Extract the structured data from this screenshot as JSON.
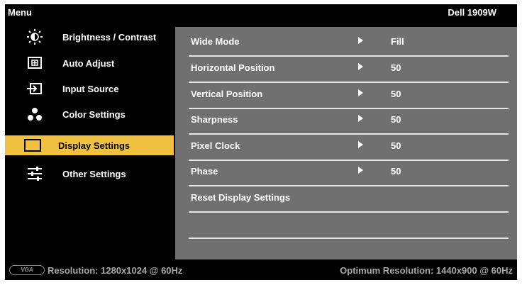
{
  "header": {
    "menu_title": "Menu",
    "model": "Dell 1909W"
  },
  "sidebar": {
    "items": [
      {
        "label": "Brightness / Contrast",
        "icon": "brightness-icon"
      },
      {
        "label": "Auto Adjust",
        "icon": "auto-adjust-icon"
      },
      {
        "label": "Input Source",
        "icon": "input-source-icon"
      },
      {
        "label": "Color Settings",
        "icon": "color-settings-icon"
      },
      {
        "label": "Display Settings",
        "icon": "display-settings-icon",
        "selected": true
      },
      {
        "label": "Other Settings",
        "icon": "other-settings-icon"
      }
    ],
    "selected_color": "#f0c040"
  },
  "panel": {
    "rows": [
      {
        "label": "Wide Mode",
        "value": "Fill"
      },
      {
        "label": "Horizontal Position",
        "value": "50"
      },
      {
        "label": "Vertical Position",
        "value": "50"
      },
      {
        "label": "Sharpness",
        "value": "50"
      },
      {
        "label": "Pixel Clock",
        "value": "50"
      },
      {
        "label": "Phase",
        "value": "50"
      },
      {
        "label": "Reset Display Settings",
        "value": ""
      },
      {
        "label": "",
        "value": ""
      }
    ],
    "background": "#707070"
  },
  "status": {
    "connector_label": "VGA",
    "resolution": "Resolution: 1280x1024 @ 60Hz",
    "optimum": "Optimum Resolution: 1440x900 @ 60Hz"
  }
}
